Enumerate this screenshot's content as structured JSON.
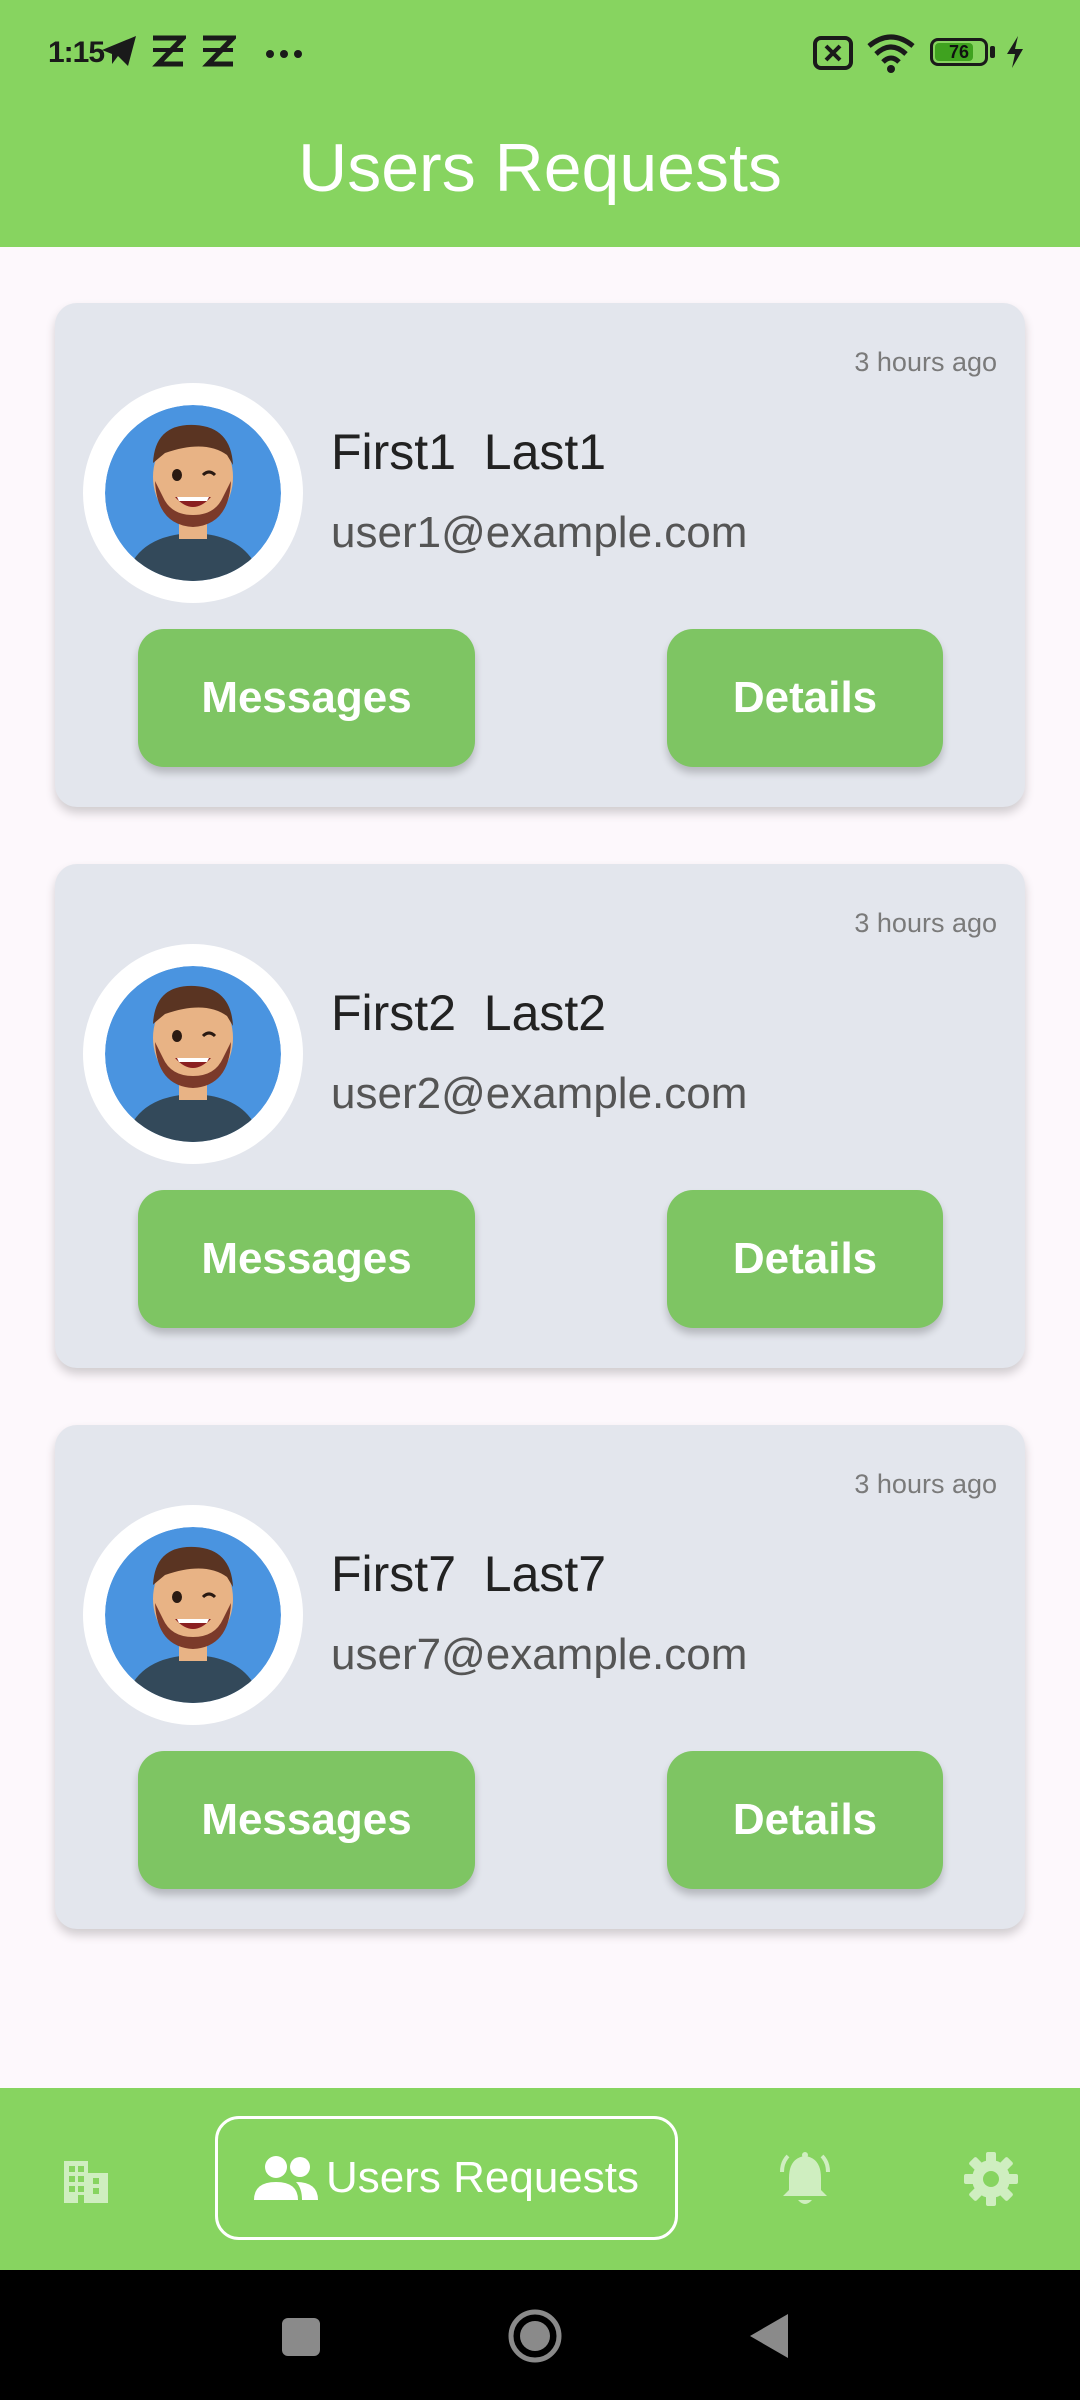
{
  "status_bar": {
    "time": "1:15",
    "battery": 76
  },
  "header": {
    "title": "Users Requests"
  },
  "requests": [
    {
      "time_ago": "3 hours ago",
      "name": "First1  Last1",
      "email": "user1@example.com",
      "messages_label": "Messages",
      "details_label": "Details"
    },
    {
      "time_ago": "3 hours ago",
      "name": "First2  Last2",
      "email": "user2@example.com",
      "messages_label": "Messages",
      "details_label": "Details"
    },
    {
      "time_ago": "3 hours ago",
      "name": "First7  Last7",
      "email": "user7@example.com",
      "messages_label": "Messages",
      "details_label": "Details"
    }
  ],
  "bottom_nav": {
    "items": [
      {
        "icon": "building-icon"
      },
      {
        "icon": "people-icon",
        "label": "Users Requests",
        "active": true
      },
      {
        "icon": "bell-icon"
      },
      {
        "icon": "gear-icon"
      }
    ]
  },
  "colors": {
    "accent": "#87d460",
    "button": "#7ec563",
    "card": "#e3e6ed",
    "avatar_bg": "#4a94e0"
  }
}
